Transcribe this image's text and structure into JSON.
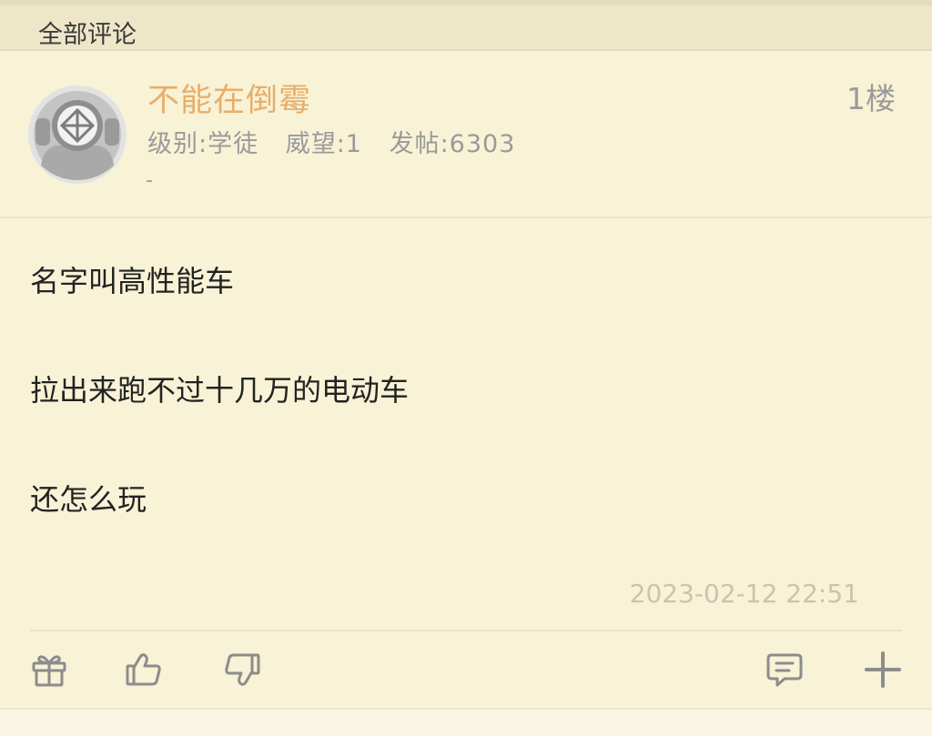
{
  "section_header": {
    "title": "全部评论"
  },
  "post": {
    "author": {
      "username": "不能在倒霉",
      "level": "级别:学徒",
      "prestige": "威望:1",
      "posts": "发帖:6303",
      "signature": "-",
      "avatar_icon": "diving-helmet-icon"
    },
    "floor": "1楼",
    "content": [
      "名字叫高性能车",
      "拉出来跑不过十几万的电动车",
      "还怎么玩"
    ],
    "timestamp": "2023-02-12 22:51",
    "actions": {
      "gift_icon": "gift-icon",
      "like_icon": "thumbs-up-icon",
      "dislike_icon": "thumbs-down-icon",
      "comment_icon": "comment-icon",
      "more_icon": "plus-icon"
    }
  },
  "colors": {
    "background": "#f8f2d6",
    "username": "#e8ae69",
    "meta_text": "#9a9a9a",
    "content_text": "#222222",
    "timestamp": "#c9c4b0"
  }
}
